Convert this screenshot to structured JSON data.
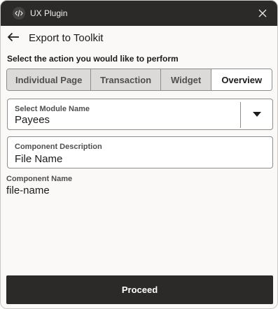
{
  "app": {
    "title": "UX Plugin"
  },
  "header": {
    "title": "Export to Toolkit"
  },
  "action": {
    "prompt": "Select the action you would like to perform",
    "options": [
      "Individual Page",
      "Transaction",
      "Widget",
      "Overview"
    ],
    "selected": "Overview"
  },
  "module_select": {
    "label": "Select Module Name",
    "value": "Payees"
  },
  "component_description": {
    "label": "Component Description",
    "value": "File Name"
  },
  "component_name": {
    "label": "Component Name",
    "value": "file-name"
  },
  "footer": {
    "proceed_label": "Proceed"
  },
  "icons": {
    "logo": "code-slash-icon",
    "close": "close-icon",
    "back": "arrow-left-icon",
    "dropdown": "caret-down-icon"
  },
  "colors": {
    "titlebar": "#2b2a29",
    "primary_button": "#2b2a29",
    "background": "#fbf9f8",
    "segment_inactive": "#dcdad8",
    "segment_active": "#ffffff"
  }
}
